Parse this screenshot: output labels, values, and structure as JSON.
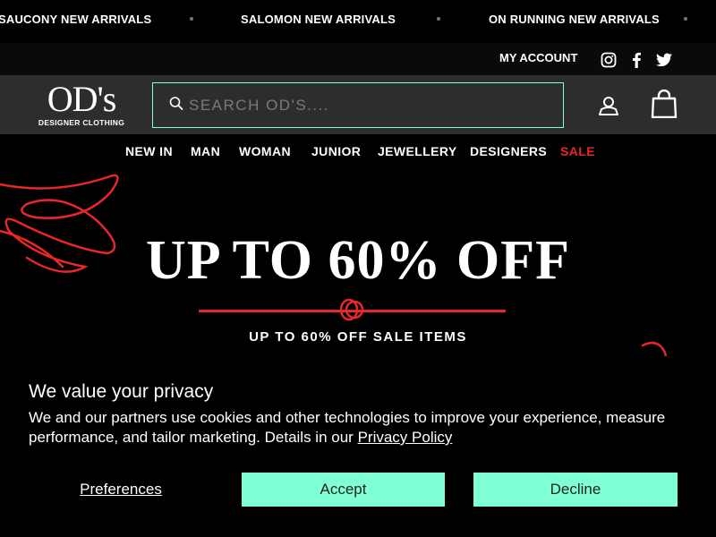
{
  "ticker": {
    "items": [
      "SAUCONY NEW ARRIVALS",
      "SALOMON NEW ARRIVALS",
      "ON RUNNING NEW ARRIVALS"
    ]
  },
  "utility": {
    "my_account": "MY ACCOUNT",
    "social_icons": [
      "instagram-icon",
      "facebook-icon",
      "twitter-icon"
    ]
  },
  "header": {
    "logo_main": "OD's",
    "logo_sub": "DESIGNER CLOTHING",
    "search_placeholder": "SEARCH OD'S....",
    "accent_color": "#7fffd4"
  },
  "nav": {
    "items": [
      "NEW IN",
      "MAN",
      "WOMAN",
      "JUNIOR",
      "JEWELLERY",
      "DESIGNERS",
      "SALE"
    ],
    "sale_color": "#e8262b"
  },
  "hero": {
    "title": "UP TO 60% OFF",
    "subtitle": "UP TO 60% OFF SALE ITEMS"
  },
  "cookie": {
    "title": "We value your privacy",
    "text": "We and our partners use cookies and other technologies to improve your experience, measure performance, and tailor marketing. Details in our",
    "link": "Privacy Policy",
    "preferences": "Preferences",
    "accept": "Accept",
    "decline": "Decline"
  }
}
